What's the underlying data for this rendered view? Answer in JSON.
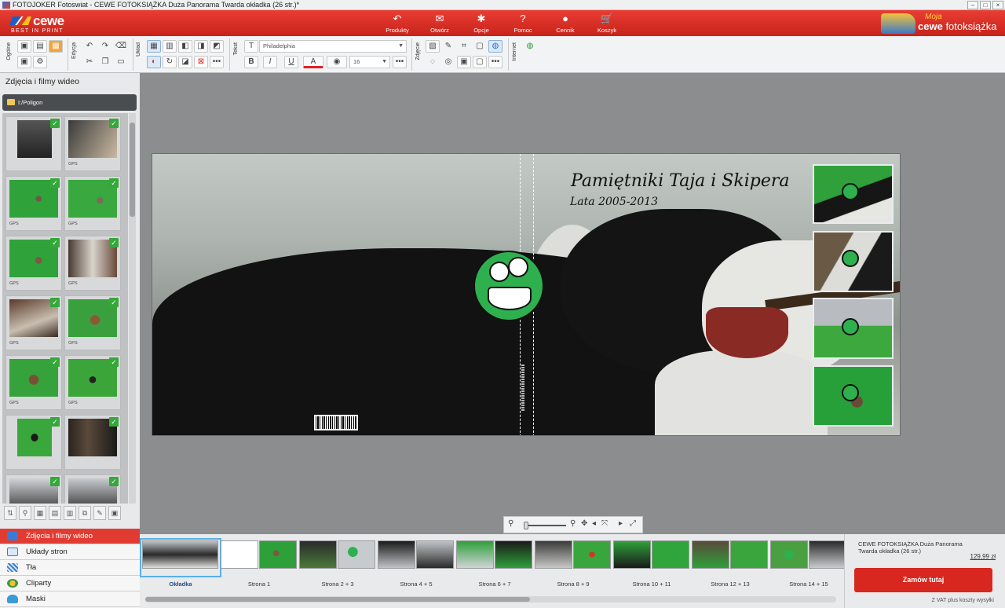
{
  "window": {
    "title": "FOTOJOKER Fotoswiat - CEWE FOTOKSIĄŻKA Duża Panorama Twarda okładka  (26 str.)*",
    "buttons": [
      "–",
      "□",
      "×"
    ]
  },
  "brand": {
    "logo": "cewe",
    "tagline": "BEST IN PRINT",
    "moja": "Moja",
    "cewe": "cewe",
    "product": "fotoksiążka"
  },
  "nav": [
    {
      "label": "Produkty",
      "icon": "arrow-icon",
      "glyph": "↶"
    },
    {
      "label": "Otwórz",
      "icon": "open-icon",
      "glyph": "✉"
    },
    {
      "label": "Opcje",
      "icon": "gear-icon",
      "glyph": "✱"
    },
    {
      "label": "Pomoc",
      "icon": "help-icon",
      "glyph": "?"
    },
    {
      "label": "Cennik",
      "icon": "coins-icon",
      "glyph": "●"
    },
    {
      "label": "Koszyk",
      "icon": "cart-icon",
      "glyph": "🛒"
    }
  ],
  "toolbar": {
    "groups": [
      "Ogólne",
      "Edycja",
      "Układ",
      "Tekst",
      "Zdjęcie",
      "Internet"
    ],
    "font": "Philadelphia",
    "size": "16",
    "bold": "B",
    "italic": "I",
    "underline": "U",
    "color": "A",
    "more": "•••"
  },
  "left_panel": {
    "title": "Zdjęcia i filmy wideo",
    "folder": "I:/Poligon",
    "gps": "GPS",
    "tabs": [
      "Zdjęcia i filmy wideo",
      "Układy stron",
      "Tła",
      "Cliparty",
      "Maski"
    ]
  },
  "cover": {
    "title": "Pamiętniki Taja i Skipera",
    "subtitle": "Lata 2005-2013"
  },
  "pages": [
    "Okładka",
    "Strona 1",
    "Strona 2 + 3",
    "Strona 4 + 5",
    "Strona 6 + 7",
    "Strona 8 + 9",
    "Strona 10 + 11",
    "Strona 12 + 13",
    "Strona 14 + 15"
  ],
  "order": {
    "product": "CEWE FOTOKSIĄŻKA Duża Panorama Twarda okładka  (26 str.)",
    "price": "129,99 zł",
    "button": "Zamów tutaj",
    "vat": "Z VAT plus koszty wysyłki"
  },
  "colors": {
    "brand_red": "#d7271f",
    "accent_green": "#2eb04f",
    "selection_blue": "#5ab0e8"
  }
}
